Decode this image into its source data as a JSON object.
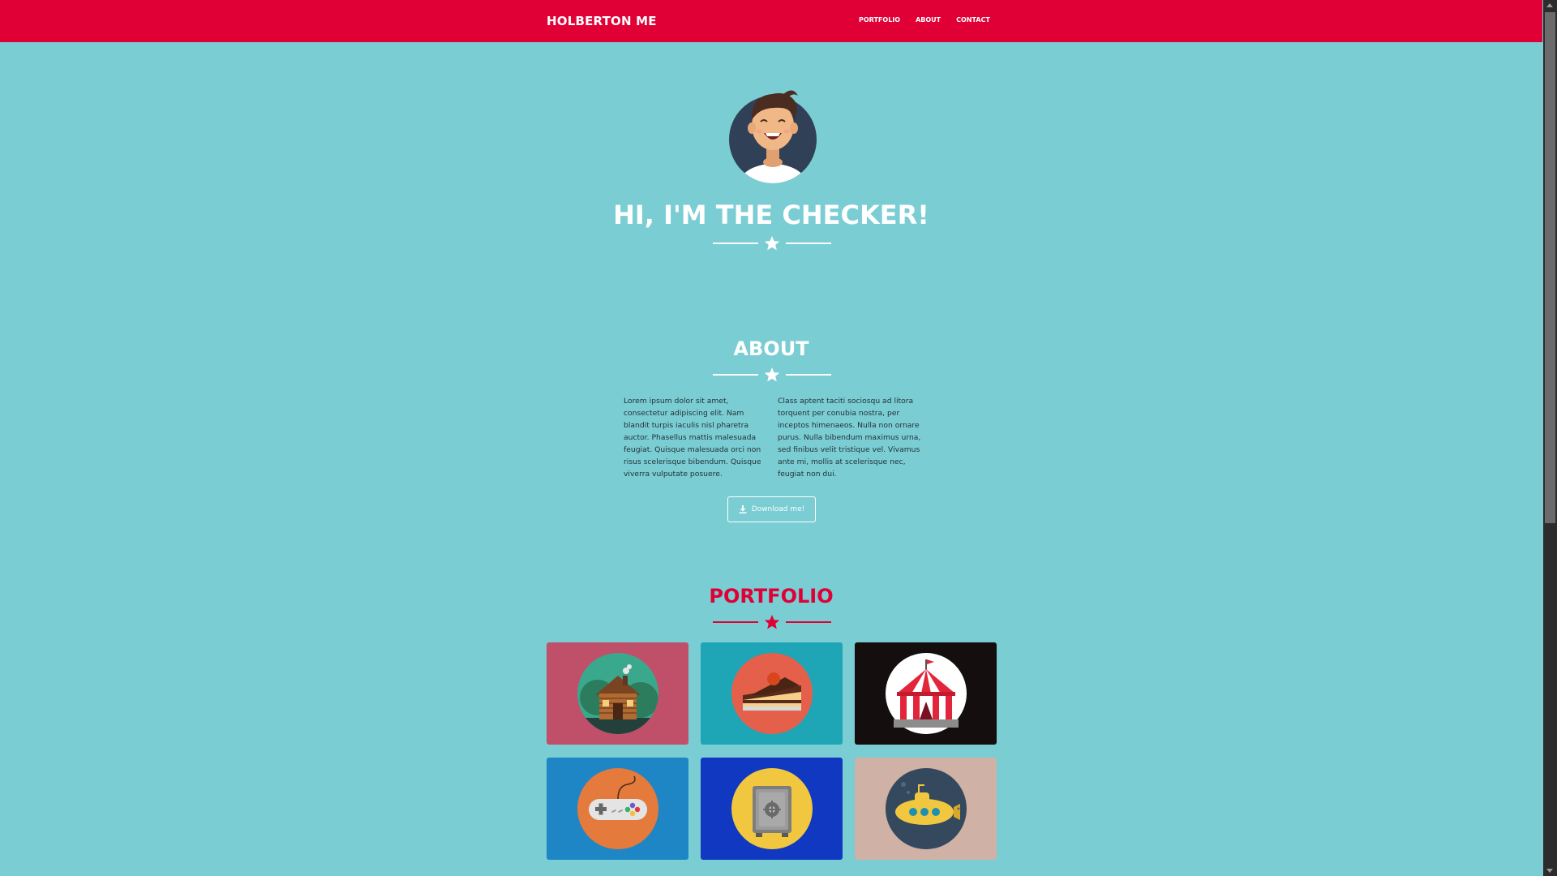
{
  "navbar": {
    "brand": "HOLBERTON ME",
    "links": [
      "PORTFOLIO",
      "ABOUT",
      "CONTACT"
    ]
  },
  "hero": {
    "title": "HI, I'M THE CHECKER!"
  },
  "about": {
    "title": "ABOUT",
    "col1": "Lorem ipsum dolor sit amet, consectetur adipiscing elit. Nam blandit turpis iaculis nisl pharetra auctor. Phasellus mattis malesuada feugiat. Quisque malesuada orci non risus scelerisque bibendum. Quisque viverra vulputate posuere.",
    "col2": "Class aptent taciti sociosqu ad litora torquent per conubia nostra, per inceptos himenaeos. Nulla non ornare purus. Nulla bibendum maximus urna, sed finibus velit tristique vel. Vivamus ante mi, mollis at scelerisque nec, feugiat non dui.",
    "download_label": "Download me!"
  },
  "portfolio": {
    "title": "PORTFOLIO",
    "tiles": [
      {
        "icon": "cabin-icon",
        "bg": "#c0506a",
        "circle": "#3aa88c"
      },
      {
        "icon": "cake-icon",
        "bg": "#1ea5b6",
        "circle": "#e5604a"
      },
      {
        "icon": "circus-tent-icon",
        "bg": "#140e0e",
        "circle": "#ffffff"
      },
      {
        "icon": "game-controller-icon",
        "bg": "#1e86c4",
        "circle": "#e47a3c"
      },
      {
        "icon": "safe-icon",
        "bg": "#1038c0",
        "circle": "#f0c73e"
      },
      {
        "icon": "submarine-icon",
        "bg": "#cfb1a5",
        "circle": "#34495e"
      }
    ]
  },
  "colors": {
    "background": "#79cdd3",
    "accent": "#e00036"
  }
}
